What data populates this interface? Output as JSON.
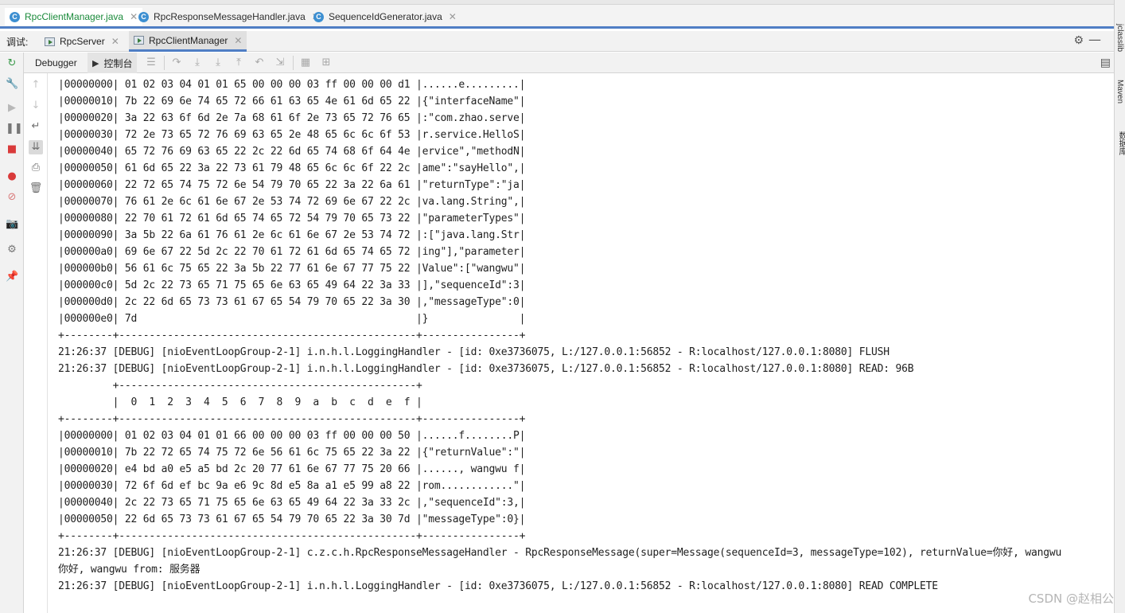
{
  "editor_tabs": [
    {
      "label": "RpcClientManager.java",
      "active": true
    },
    {
      "label": "RpcResponseMessageHandler.java",
      "active": false
    },
    {
      "label": "SequenceIdGenerator.java",
      "active": false
    }
  ],
  "debug_bar": {
    "label": "调试:",
    "tabs": [
      {
        "label": "RpcServer",
        "active": false
      },
      {
        "label": "RpcClientManager",
        "active": true
      }
    ]
  },
  "sub_bar": {
    "debugger_label": "Debugger",
    "console_label": "控制台"
  },
  "right_stripe": {
    "items": [
      "jclasslib",
      "Maven",
      "数据库"
    ]
  },
  "console_lines": [
    "|00000000| 01 02 03 04 01 01 65 00 00 00 03 ff 00 00 00 d1 |......e.........|",
    "|00000010| 7b 22 69 6e 74 65 72 66 61 63 65 4e 61 6d 65 22 |{\"interfaceName\"|",
    "|00000020| 3a 22 63 6f 6d 2e 7a 68 61 6f 2e 73 65 72 76 65 |:\"com.zhao.serve|",
    "|00000030| 72 2e 73 65 72 76 69 63 65 2e 48 65 6c 6c 6f 53 |r.service.HelloS|",
    "|00000040| 65 72 76 69 63 65 22 2c 22 6d 65 74 68 6f 64 4e |ervice\",\"methodN|",
    "|00000050| 61 6d 65 22 3a 22 73 61 79 48 65 6c 6c 6f 22 2c |ame\":\"sayHello\",|",
    "|00000060| 22 72 65 74 75 72 6e 54 79 70 65 22 3a 22 6a 61 |\"returnType\":\"ja|",
    "|00000070| 76 61 2e 6c 61 6e 67 2e 53 74 72 69 6e 67 22 2c |va.lang.String\",|",
    "|00000080| 22 70 61 72 61 6d 65 74 65 72 54 79 70 65 73 22 |\"parameterTypes\"|",
    "|00000090| 3a 5b 22 6a 61 76 61 2e 6c 61 6e 67 2e 53 74 72 |:[\"java.lang.Str|",
    "|000000a0| 69 6e 67 22 5d 2c 22 70 61 72 61 6d 65 74 65 72 |ing\"],\"parameter|",
    "|000000b0| 56 61 6c 75 65 22 3a 5b 22 77 61 6e 67 77 75 22 |Value\":[\"wangwu\"|",
    "|000000c0| 5d 2c 22 73 65 71 75 65 6e 63 65 49 64 22 3a 33 |],\"sequenceId\":3|",
    "|000000d0| 2c 22 6d 65 73 73 61 67 65 54 79 70 65 22 3a 30 |,\"messageType\":0|",
    "|000000e0| 7d                                              |}               |",
    "+--------+-------------------------------------------------+----------------+",
    "21:26:37 [DEBUG] [nioEventLoopGroup-2-1] i.n.h.l.LoggingHandler - [id: 0xe3736075, L:/127.0.0.1:56852 - R:localhost/127.0.0.1:8080] FLUSH",
    "21:26:37 [DEBUG] [nioEventLoopGroup-2-1] i.n.h.l.LoggingHandler - [id: 0xe3736075, L:/127.0.0.1:56852 - R:localhost/127.0.0.1:8080] READ: 96B",
    "         +-------------------------------------------------+",
    "         |  0  1  2  3  4  5  6  7  8  9  a  b  c  d  e  f |",
    "+--------+-------------------------------------------------+----------------+",
    "|00000000| 01 02 03 04 01 01 66 00 00 00 03 ff 00 00 00 50 |......f........P|",
    "|00000010| 7b 22 72 65 74 75 72 6e 56 61 6c 75 65 22 3a 22 |{\"returnValue\":\"|",
    "|00000020| e4 bd a0 e5 a5 bd 2c 20 77 61 6e 67 77 75 20 66 |......, wangwu f|",
    "|00000030| 72 6f 6d ef bc 9a e6 9c 8d e5 8a a1 e5 99 a8 22 |rom............\"|",
    "|00000040| 2c 22 73 65 71 75 65 6e 63 65 49 64 22 3a 33 2c |,\"sequenceId\":3,|",
    "|00000050| 22 6d 65 73 73 61 67 65 54 79 70 65 22 3a 30 7d |\"messageType\":0}|",
    "+--------+-------------------------------------------------+----------------+",
    "21:26:37 [DEBUG] [nioEventLoopGroup-2-1] c.z.c.h.RpcResponseMessageHandler - RpcResponseMessage(super=Message(sequenceId=3, messageType=102), returnValue=你好, wangwu",
    "你好, wangwu from: 服务器",
    "21:26:37 [DEBUG] [nioEventLoopGroup-2-1] i.n.h.l.LoggingHandler - [id: 0xe3736075, L:/127.0.0.1:56852 - R:localhost/127.0.0.1:8080] READ COMPLETE"
  ],
  "watermark": "CSDN @赵相公"
}
